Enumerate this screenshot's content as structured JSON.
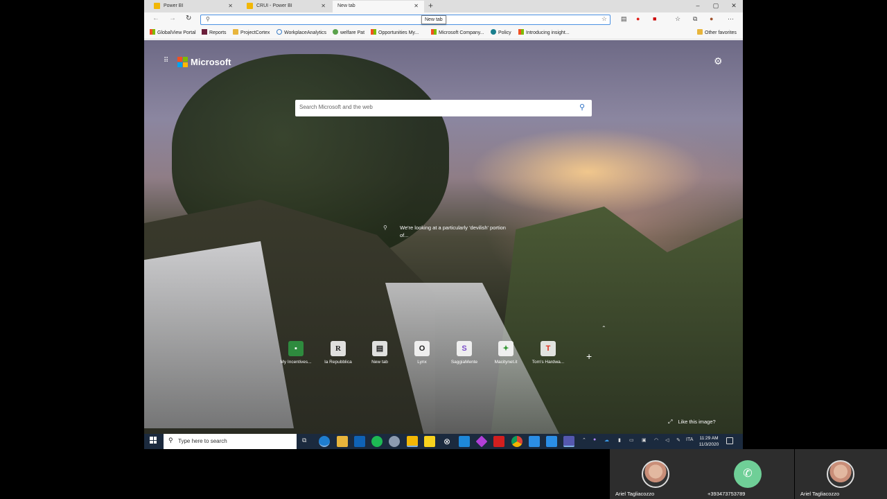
{
  "browser": {
    "tabs": [
      {
        "label": "Power BI"
      },
      {
        "label": "CRUI - Power BI"
      },
      {
        "label": "New tab"
      }
    ],
    "tooltip": "New tab",
    "address_value": "",
    "favorites": [
      {
        "label": "GlobalView Portal",
        "icon": "microsoft-icon"
      },
      {
        "label": "Reports",
        "icon": "reports-icon"
      },
      {
        "label": "ProjectCortex",
        "icon": "folder-icon"
      },
      {
        "label": "WorkplaceAnalytics",
        "icon": "analytics-icon"
      },
      {
        "label": "welfare Pat",
        "icon": "link-icon"
      },
      {
        "label": "Opportunities My...",
        "icon": "microsoft-icon"
      },
      {
        "label": "Microsoft Company...",
        "icon": "microsoft-icon"
      },
      {
        "label": "Policy",
        "icon": "policy-icon"
      },
      {
        "label": "Introducing insight...",
        "icon": "microsoft-icon"
      }
    ],
    "other_favorites": "Other favorites"
  },
  "ntp": {
    "brand": "Microsoft",
    "search_placeholder": "Search Microsoft and the web",
    "caption": "We're looking at a particularly 'devilish' portion of...",
    "tiles": [
      {
        "label": "My Incentives...",
        "glyph": "▪"
      },
      {
        "label": "la Repubblica",
        "glyph": "R"
      },
      {
        "label": "New tab",
        "glyph": "▤"
      },
      {
        "label": "Lynx",
        "glyph": "O"
      },
      {
        "label": "SaggiaMente",
        "glyph": "S"
      },
      {
        "label": "Macitynet.it",
        "glyph": "✦"
      },
      {
        "label": "Tom's Hardwa...",
        "glyph": "T"
      }
    ],
    "like_image": "Like this image?"
  },
  "taskbar": {
    "search_placeholder": "Type here to search",
    "language": "ITA",
    "time": "11:29 AM",
    "date": "11/3/2020"
  },
  "participants": [
    {
      "name": "Ariel Tagliacozzo"
    },
    {
      "name": "+393473753789"
    },
    {
      "name": "Ariel Tagliacozzo"
    }
  ],
  "colors": {
    "accent": "#2b6fc4",
    "taskbar": "#1b2a3e",
    "phone_avatar": "#6fcf97"
  }
}
